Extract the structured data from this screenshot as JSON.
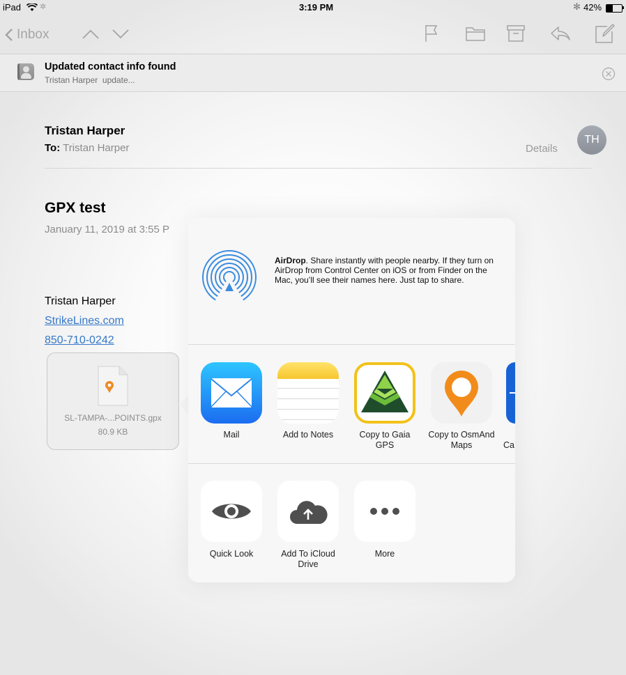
{
  "status_bar": {
    "device": "iPad",
    "time": "3:19 PM",
    "battery": "42%"
  },
  "nav": {
    "back_label": "Inbox"
  },
  "banner": {
    "title": "Updated contact info found",
    "subtitle": "Tristan Harper  update..."
  },
  "email": {
    "sender": "Tristan Harper",
    "to_label": "To:",
    "to_value": "Tristan Harper",
    "details_label": "Details",
    "avatar_initials": "TH",
    "subject": "GPX test",
    "date": "January 11, 2019 at 3:55 P",
    "signature_name": "Tristan Harper",
    "signature_link": "StrikeLines.com",
    "signature_phone": "850-710-0242",
    "attachment_name": "SL-TAMPA-...POINTS.gpx",
    "attachment_size": "80.9 KB"
  },
  "share_sheet": {
    "airdrop_title": "AirDrop",
    "airdrop_text": ". Share instantly with people nearby. If they turn on AirDrop from Control Center on iOS or from Finder on the Mac, you’ll see their names here. Just tap to share.",
    "apps": [
      {
        "label": "Mail",
        "icon": "mail-app-icon"
      },
      {
        "label": "Add to Notes",
        "icon": "notes-app-icon"
      },
      {
        "label": "Copy to Gaia GPS",
        "icon": "gaia-gps-app-icon"
      },
      {
        "label": "Copy to OsmAnd Maps",
        "icon": "osmand-maps-app-icon"
      },
      {
        "label": "Ca",
        "icon": "partial-app-icon"
      }
    ],
    "actions": [
      {
        "label": "Quick Look",
        "icon": "eye-icon"
      },
      {
        "label": "Add To iCloud Drive",
        "icon": "icloud-upload-icon"
      },
      {
        "label": "More",
        "icon": "more-ellipsis-icon"
      }
    ]
  }
}
